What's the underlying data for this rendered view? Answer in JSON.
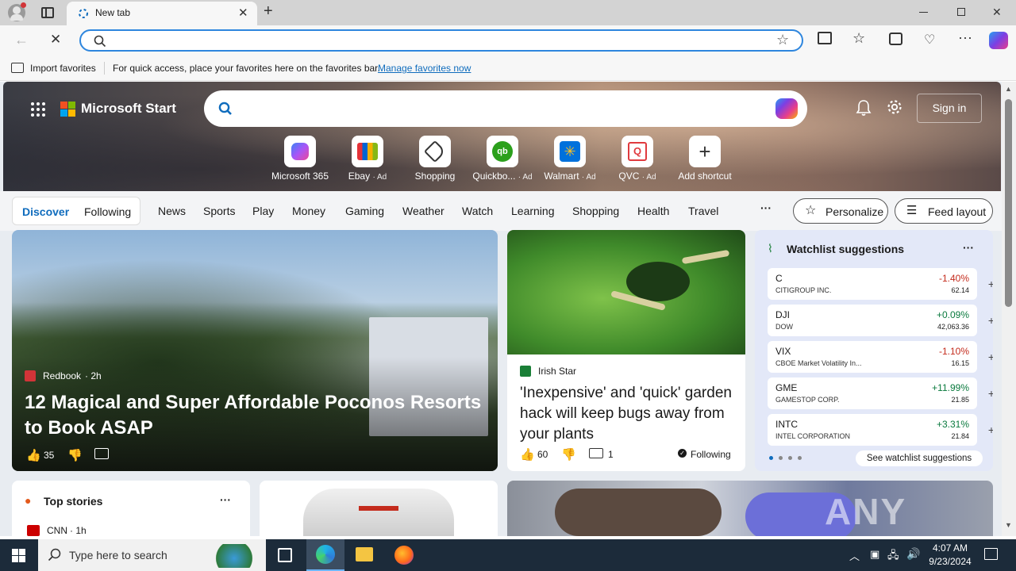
{
  "browser": {
    "tab_title": "New tab",
    "address_placeholder": "",
    "favorites_bar": {
      "import_label": "Import favorites",
      "message": "For quick access, place your favorites here on the favorites bar.",
      "manage_link": "Manage favorites now"
    }
  },
  "page": {
    "brand": "Microsoft Start",
    "search_placeholder": "",
    "sign_in": "Sign in",
    "shortcuts": [
      {
        "label": "Microsoft 365",
        "ad": ""
      },
      {
        "label": "Ebay",
        "ad": "· Ad"
      },
      {
        "label": "Shopping",
        "ad": ""
      },
      {
        "label": "Quickbo...",
        "ad": "· Ad"
      },
      {
        "label": "Walmart",
        "ad": "· Ad"
      },
      {
        "label": "QVC",
        "ad": "· Ad"
      },
      {
        "label": "Add shortcut",
        "ad": ""
      }
    ],
    "nav": {
      "discover": "Discover",
      "following": "Following",
      "items": [
        "News",
        "Sports",
        "Play",
        "Money",
        "Gaming",
        "Weather",
        "Watch",
        "Learning",
        "Shopping",
        "Health",
        "Travel"
      ],
      "more": "···",
      "personalize": "Personalize",
      "feed_layout": "Feed layout"
    },
    "hero_article": {
      "source": "Redbook",
      "time": "· 2h",
      "title": "12 Magical and Super Affordable Poconos Resorts to Book ASAP",
      "likes": "35"
    },
    "second_article": {
      "source": "Irish Star",
      "title": "'Inexpensive' and 'quick' garden hack will keep bugs away from your plants",
      "likes": "60",
      "comments": "1",
      "following": "Following"
    },
    "watchlist": {
      "title": "Watchlist suggestions",
      "more": "···",
      "stocks": [
        {
          "symbol": "C",
          "name": "CITIGROUP INC.",
          "change": "-1.40%",
          "price": "62.14",
          "color": "#c42b1c"
        },
        {
          "symbol": "DJI",
          "name": "DOW",
          "change": "+0.09%",
          "price": "42,063.36",
          "color": "#0a7a3e"
        },
        {
          "symbol": "VIX",
          "name": "CBOE Market Volatility In...",
          "change": "-1.10%",
          "price": "16.15",
          "color": "#c42b1c"
        },
        {
          "symbol": "GME",
          "name": "GAMESTOP CORP.",
          "change": "+11.99%",
          "price": "21.85",
          "color": "#0a7a3e"
        },
        {
          "symbol": "INTC",
          "name": "INTEL CORPORATION",
          "change": "+3.31%",
          "price": "21.84",
          "color": "#0a7a3e"
        }
      ],
      "see_more": "See watchlist suggestions"
    },
    "top_stories": {
      "title": "Top stories",
      "more": "···",
      "first_source": "CNN",
      "first_time": "· 1h"
    },
    "watermark": "ANY RUN"
  },
  "taskbar": {
    "search_placeholder": "Type here to search",
    "time": "4:07 AM",
    "date": "9/23/2024"
  },
  "colors": {
    "accent": "#0f6cbd",
    "taskbar": "#1c2b3a"
  }
}
